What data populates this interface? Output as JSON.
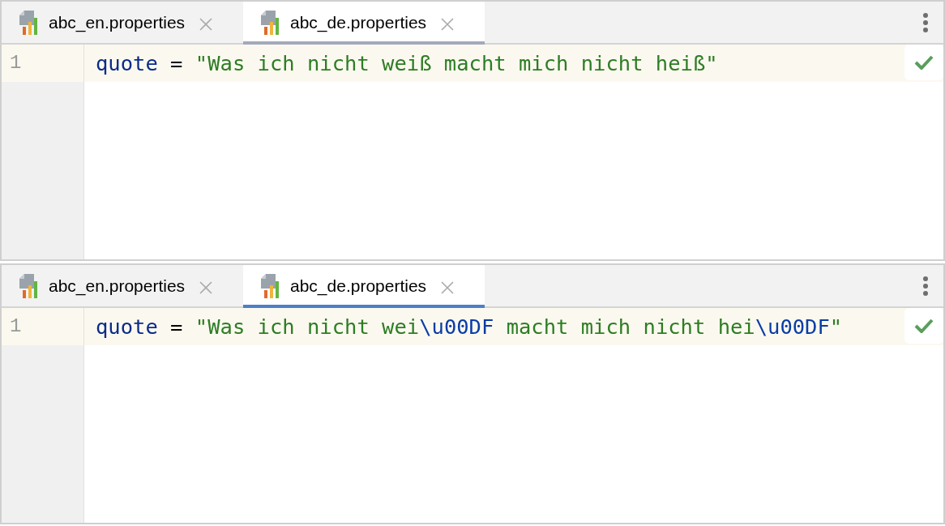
{
  "panes": [
    {
      "focused": false,
      "tabs": [
        {
          "label": "abc_en.properties",
          "selected": false
        },
        {
          "label": "abc_de.properties",
          "selected": true
        }
      ],
      "lines": [
        {
          "number": "1",
          "current": true,
          "tokens": [
            {
              "kind": "key",
              "text": "quote"
            },
            {
              "kind": "operator",
              "text": " = "
            },
            {
              "kind": "string",
              "text": "\"Was ich nicht weiß macht mich nicht heiß\""
            }
          ]
        }
      ]
    },
    {
      "focused": true,
      "tabs": [
        {
          "label": "abc_en.properties",
          "selected": false
        },
        {
          "label": "abc_de.properties",
          "selected": true
        }
      ],
      "lines": [
        {
          "number": "1",
          "current": true,
          "tokens": [
            {
              "kind": "key",
              "text": "quote"
            },
            {
              "kind": "operator",
              "text": " = "
            },
            {
              "kind": "string",
              "text": "\"Was ich nicht wei"
            },
            {
              "kind": "escape",
              "text": "\\u00DF"
            },
            {
              "kind": "string",
              "text": " macht mich nicht hei"
            },
            {
              "kind": "escape",
              "text": "\\u00DF"
            },
            {
              "kind": "string",
              "text": "\""
            }
          ]
        }
      ]
    }
  ]
}
